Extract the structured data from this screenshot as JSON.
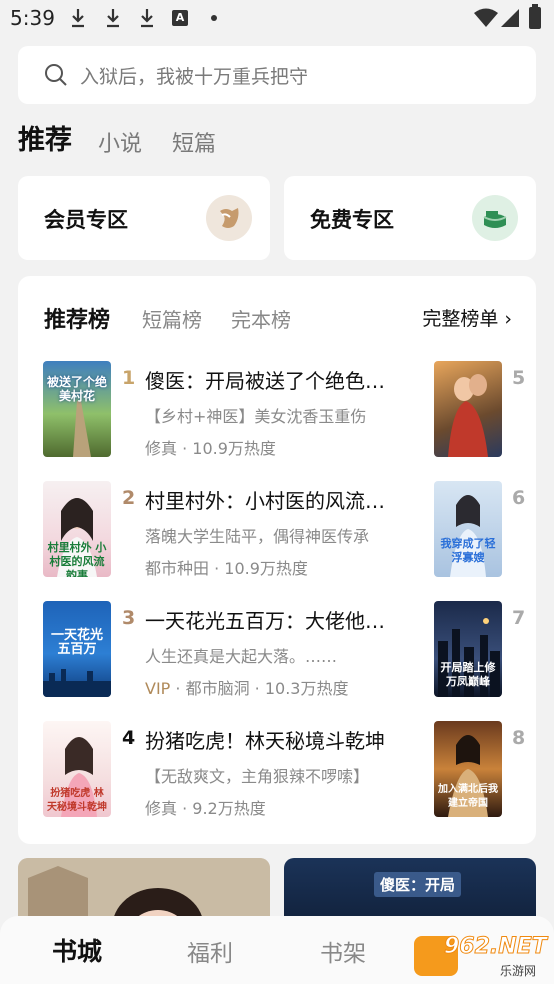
{
  "status_bar": {
    "time": "5:39"
  },
  "search": {
    "placeholder": "入狱后，我被十万重兵把守"
  },
  "top_tabs": [
    "推荐",
    "小说",
    "短篇"
  ],
  "zones": [
    {
      "label": "会员专区",
      "icon": "vip-badge-icon"
    },
    {
      "label": "免费专区",
      "icon": "free-badge-icon"
    }
  ],
  "ranking": {
    "tabs": [
      "推荐榜",
      "短篇榜",
      "完本榜"
    ],
    "full_list_label": "完整榜单",
    "books": [
      {
        "rank": "1",
        "title": "傻医：开局被送了个绝色老婆",
        "desc": "【乡村+神医】美女沈香玉重伤",
        "tag": "",
        "meta": "修真 · 10.9万热度",
        "cover_text": "被送了个绝美村花",
        "rank_color": "#c8a46a"
      },
      {
        "rank": "2",
        "title": "村里村外：小村医的风流韵事",
        "desc": "落魄大学生陆平，偶得神医传承",
        "tag": "",
        "meta": "都市种田 · 10.9万热度",
        "cover_text": "村里村外 小村医的风流韵事",
        "rank_color": "#b08a6a"
      },
      {
        "rank": "3",
        "title": "一天花光五百万：大佬他超有钱",
        "desc": "人生还真是大起大落。……",
        "tag": "VIP",
        "meta": "都市脑洞 · 10.3万热度",
        "cover_text": "一天花光五百万",
        "rank_color": "#b08a6a"
      },
      {
        "rank": "4",
        "title": "扮猪吃虎！林天秘境斗乾坤",
        "desc": "【无敌爽文，主角狠辣不啰嗦】",
        "tag": "",
        "meta": "修真 · 9.2万热度",
        "cover_text": "扮猪吃虎 林天秘境斗乾坤",
        "rank_color": "#111111"
      }
    ],
    "side_books": [
      {
        "rank": "5",
        "cover_text": ""
      },
      {
        "rank": "6",
        "cover_text": "我穿成了轻浮寡嫂"
      },
      {
        "rank": "7",
        "cover_text": "开局踏上修万凤巅峰"
      },
      {
        "rank": "8",
        "cover_text": "加入满北后我建立帝国"
      }
    ]
  },
  "banners": [
    {
      "label": ""
    },
    {
      "label": "傻医：开局"
    }
  ],
  "bottom_nav": [
    "书城",
    "福利",
    "书架"
  ],
  "watermark": {
    "brand": "962.NET",
    "sub": "乐游网"
  }
}
